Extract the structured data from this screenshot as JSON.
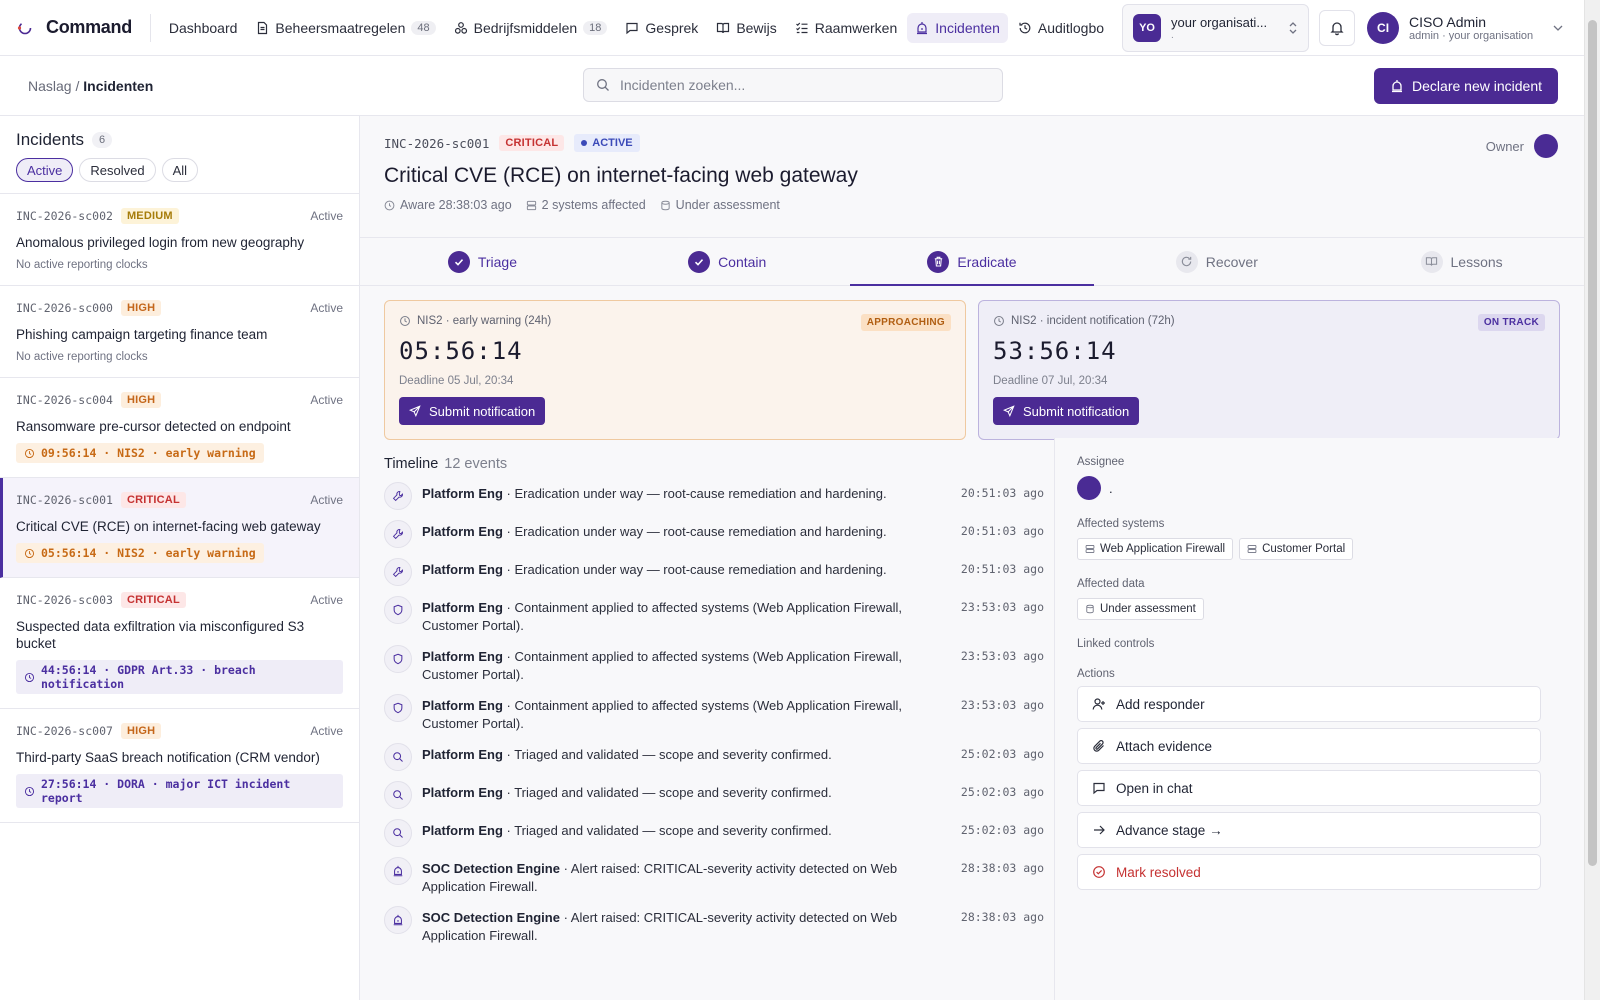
{
  "app": {
    "name": "Command"
  },
  "nav": [
    {
      "label": "Dashboard",
      "icon": "none",
      "count": null,
      "active": false
    },
    {
      "label": "Beheersmaatregelen",
      "icon": "document-icon",
      "count": "48",
      "active": false
    },
    {
      "label": "Bedrijfsmiddelen",
      "icon": "assets-icon",
      "count": "18",
      "active": false
    },
    {
      "label": "Gesprek",
      "icon": "chat-icon",
      "count": null,
      "active": false
    },
    {
      "label": "Bewijs",
      "icon": "book-icon",
      "count": null,
      "active": false
    },
    {
      "label": "Raamwerken",
      "icon": "checklist-icon",
      "count": null,
      "active": false
    },
    {
      "label": "Incidenten",
      "icon": "siren-icon",
      "count": null,
      "active": true
    },
    {
      "label": "Auditlogbo",
      "icon": "history-icon",
      "count": null,
      "active": false
    }
  ],
  "org": {
    "avatar": "YO",
    "name": "your organisati...",
    "sub": "."
  },
  "user": {
    "avatar": "CI",
    "name": "CISO Admin",
    "sub": "admin · your organisation"
  },
  "breadcrumb": {
    "parent": "Naslag",
    "sep": "/",
    "current": "Incidenten"
  },
  "search": {
    "placeholder": "Incidenten zoeken..."
  },
  "declare_button": "Declare new incident",
  "list": {
    "title": "Incidents",
    "count": "6",
    "filters": [
      "Active",
      "Resolved",
      "All"
    ],
    "items": [
      {
        "id": "INC-2026-sc002",
        "severity": "MEDIUM",
        "sev_class": "medium",
        "status": "Active",
        "title": "Anomalous privileged login from new geography",
        "sub": "No active reporting clocks",
        "clock": null,
        "selected": false
      },
      {
        "id": "INC-2026-sc000",
        "severity": "HIGH",
        "sev_class": "high",
        "status": "Active",
        "title": "Phishing campaign targeting finance team",
        "sub": "No active reporting clocks",
        "clock": null,
        "selected": false
      },
      {
        "id": "INC-2026-sc004",
        "severity": "HIGH",
        "sev_class": "high",
        "status": "Active",
        "title": "Ransomware pre-cursor detected on endpoint",
        "sub": null,
        "clock": "09:56:14 · NIS2 · early warning",
        "clock_color": "orange",
        "selected": false
      },
      {
        "id": "INC-2026-sc001",
        "severity": "CRITICAL",
        "sev_class": "critical",
        "status": "Active",
        "title": "Critical CVE (RCE) on internet-facing web gateway",
        "sub": null,
        "clock": "05:56:14 · NIS2 · early warning",
        "clock_color": "orange",
        "selected": true
      },
      {
        "id": "INC-2026-sc003",
        "severity": "CRITICAL",
        "sev_class": "critical",
        "status": "Active",
        "title": "Suspected data exfiltration via misconfigured S3 bucket",
        "sub": null,
        "clock": "44:56:14 · GDPR Art.33 · breach notification",
        "clock_color": "purple",
        "selected": false
      },
      {
        "id": "INC-2026-sc007",
        "severity": "HIGH",
        "sev_class": "high",
        "status": "Active",
        "title": "Third-party SaaS breach notification (CRM vendor)",
        "sub": null,
        "clock": "27:56:14 · DORA · major ICT incident report",
        "clock_color": "purple",
        "selected": false
      }
    ]
  },
  "detail": {
    "id": "INC-2026-sc001",
    "severity": "CRITICAL",
    "state": "ACTIVE",
    "owner_label": "Owner",
    "title": "Critical CVE (RCE) on internet-facing web gateway",
    "meta": {
      "aware": "Aware 28:38:03 ago",
      "systems": "2 systems affected",
      "data": "Under assessment"
    },
    "steps": [
      {
        "label": "Triage",
        "state": "done"
      },
      {
        "label": "Contain",
        "state": "done"
      },
      {
        "label": "Eradicate",
        "state": "current"
      },
      {
        "label": "Recover",
        "state": "todo"
      },
      {
        "label": "Lessons",
        "state": "todo"
      }
    ],
    "clocks": [
      {
        "label": "NIS2 · early warning (24h)",
        "pill": "APPROACHING",
        "time": "05:56:14",
        "deadline": "Deadline 05 Jul, 20:34",
        "button": "Submit notification",
        "color": "orange"
      },
      {
        "label": "NIS2 · incident notification (72h)",
        "pill": "ON TRACK",
        "time": "53:56:14",
        "deadline": "Deadline 07 Jul, 20:34",
        "button": "Submit notification",
        "color": "purple"
      }
    ],
    "timeline": {
      "title": "Timeline",
      "count": "12 events",
      "events": [
        {
          "actor": "Platform Eng",
          "text": " · Eradication under way — root-cause remediation and hardening.",
          "time": "20:51:03 ago",
          "icon": "wrench-icon"
        },
        {
          "actor": "Platform Eng",
          "text": " · Eradication under way — root-cause remediation and hardening.",
          "time": "20:51:03 ago",
          "icon": "wrench-icon"
        },
        {
          "actor": "Platform Eng",
          "text": " · Eradication under way — root-cause remediation and hardening.",
          "time": "20:51:03 ago",
          "icon": "wrench-icon"
        },
        {
          "actor": "Platform Eng",
          "text": " · Containment applied to affected systems (Web Application Firewall, Customer Portal).",
          "time": "23:53:03 ago",
          "icon": "shield-icon"
        },
        {
          "actor": "Platform Eng",
          "text": " · Containment applied to affected systems (Web Application Firewall, Customer Portal).",
          "time": "23:53:03 ago",
          "icon": "shield-icon"
        },
        {
          "actor": "Platform Eng",
          "text": " · Containment applied to affected systems (Web Application Firewall, Customer Portal).",
          "time": "23:53:03 ago",
          "icon": "shield-icon"
        },
        {
          "actor": "Platform Eng",
          "text": " · Triaged and validated — scope and severity confirmed.",
          "time": "25:02:03 ago",
          "icon": "search-icon"
        },
        {
          "actor": "Platform Eng",
          "text": " · Triaged and validated — scope and severity confirmed.",
          "time": "25:02:03 ago",
          "icon": "search-icon"
        },
        {
          "actor": "Platform Eng",
          "text": " · Triaged and validated — scope and severity confirmed.",
          "time": "25:02:03 ago",
          "icon": "search-icon"
        },
        {
          "actor": "SOC Detection Engine",
          "text": " · Alert raised: CRITICAL-severity activity detected on Web Application Firewall.",
          "time": "28:38:03 ago",
          "icon": "siren-icon"
        },
        {
          "actor": "SOC Detection Engine",
          "text": " · Alert raised: CRITICAL-severity activity detected on Web Application Firewall.",
          "time": "28:38:03 ago",
          "icon": "siren-icon"
        }
      ]
    },
    "side": {
      "assignee_label": "Assignee",
      "assignee_name": ".",
      "systems_label": "Affected systems",
      "systems": [
        "Web Application Firewall",
        "Customer Portal"
      ],
      "data_label": "Affected data",
      "data": [
        "Under assessment"
      ],
      "controls_label": "Linked controls",
      "actions_label": "Actions",
      "actions": [
        {
          "label": "Add responder",
          "icon": "user-plus-icon",
          "danger": false
        },
        {
          "label": "Attach evidence",
          "icon": "paperclip-icon",
          "danger": false
        },
        {
          "label": "Open in chat",
          "icon": "chat-icon",
          "danger": false
        },
        {
          "label": "Advance stage →",
          "icon": "arrow-right-icon",
          "danger": false
        },
        {
          "label": "Mark resolved",
          "icon": "check-circle-icon",
          "danger": true
        }
      ]
    }
  }
}
